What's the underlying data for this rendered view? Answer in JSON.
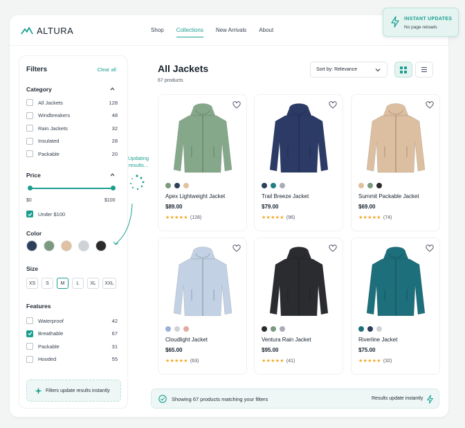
{
  "brand": {
    "name": "ALTURA"
  },
  "nav": {
    "items": [
      "Shop",
      "Collections",
      "New Arrivals",
      "About"
    ],
    "active": "Collections"
  },
  "toast": {
    "title": "INSTANT UPDATES",
    "subtitle": "No page reloads"
  },
  "filters": {
    "title": "Filters",
    "clear_label": "Clear all",
    "category": {
      "heading": "Category",
      "items": [
        {
          "label": "All Jackets",
          "count": "128",
          "checked": false
        },
        {
          "label": "Windbreakers",
          "count": "48",
          "checked": false
        },
        {
          "label": "Rain Jackets",
          "count": "32",
          "checked": false
        },
        {
          "label": "Insulated",
          "count": "28",
          "checked": false
        },
        {
          "label": "Packable",
          "count": "20",
          "checked": false
        }
      ]
    },
    "price": {
      "heading": "Price",
      "min_label": "$0",
      "max_label": "$100",
      "option_label": "Under $100",
      "option_checked": true,
      "range_low": 0,
      "range_high": 100
    },
    "color": {
      "heading": "Color",
      "swatches": [
        "#2e3f5c",
        "#7a9a7e",
        "#e0c1a0",
        "#cfd3d8",
        "#2b2b2b"
      ]
    },
    "size": {
      "heading": "Size",
      "options": [
        "XS",
        "S",
        "M",
        "L",
        "XL",
        "XXL"
      ],
      "selected": "M"
    },
    "features": {
      "heading": "Features",
      "items": [
        {
          "label": "Waterproof",
          "count": "42",
          "checked": false
        },
        {
          "label": "Breathable",
          "count": "67",
          "checked": true
        },
        {
          "label": "Packable",
          "count": "31",
          "checked": false
        },
        {
          "label": "Hooded",
          "count": "55",
          "checked": false
        }
      ]
    },
    "note": "Filters update results instantly"
  },
  "updating": {
    "line1": "Updating",
    "line2": "results..."
  },
  "main": {
    "title": "All Jackets",
    "subtitle": "67 products",
    "sort_label": "Sort by: Relevance",
    "view_active": "grid"
  },
  "products": [
    {
      "name": "Apex Lightweight Jacket",
      "price": "$89.00",
      "reviews": "(128)",
      "rating": 4.5,
      "color": "#86a88a",
      "dots": [
        "#7a9a7e",
        "#2e3f5c",
        "#e0c1a0"
      ]
    },
    {
      "name": "Trail Breeze Jacket",
      "price": "$79.00",
      "reviews": "(96)",
      "rating": 4.5,
      "color": "#2c3a66",
      "dots": [
        "#2e3f5c",
        "#1f7e86",
        "#a7adb3"
      ]
    },
    {
      "name": "Summit Packable Jacket",
      "price": "$69.00",
      "reviews": "(74)",
      "rating": 4.5,
      "color": "#dcbfa0",
      "dots": [
        "#e0c1a0",
        "#7a9a7e",
        "#2b2b2b"
      ]
    },
    {
      "name": "Cloudlight Jacket",
      "price": "$65.00",
      "reviews": "(63)",
      "rating": 4.5,
      "color": "#c2d1e4",
      "dots": [
        "#9ab2d8",
        "#cfd3d8",
        "#e4a9a3"
      ]
    },
    {
      "name": "Ventura Rain Jacket",
      "price": "$95.00",
      "reviews": "(41)",
      "rating": 4.5,
      "color": "#2a2c30",
      "dots": [
        "#2b2b2b",
        "#7a9a7e",
        "#a7adb3"
      ]
    },
    {
      "name": "Riverline Jacket",
      "price": "$75.00",
      "reviews": "(32)",
      "rating": 4.5,
      "color": "#1d6f7c",
      "dots": [
        "#1d6f7c",
        "#2e3f5c",
        "#cfd3d8"
      ]
    }
  ],
  "footer": {
    "status": "Showing 67 products matching your filters",
    "note": "Results update instantly"
  },
  "colors": {
    "accent": "#1a9e8f",
    "star": "#f5a623"
  }
}
